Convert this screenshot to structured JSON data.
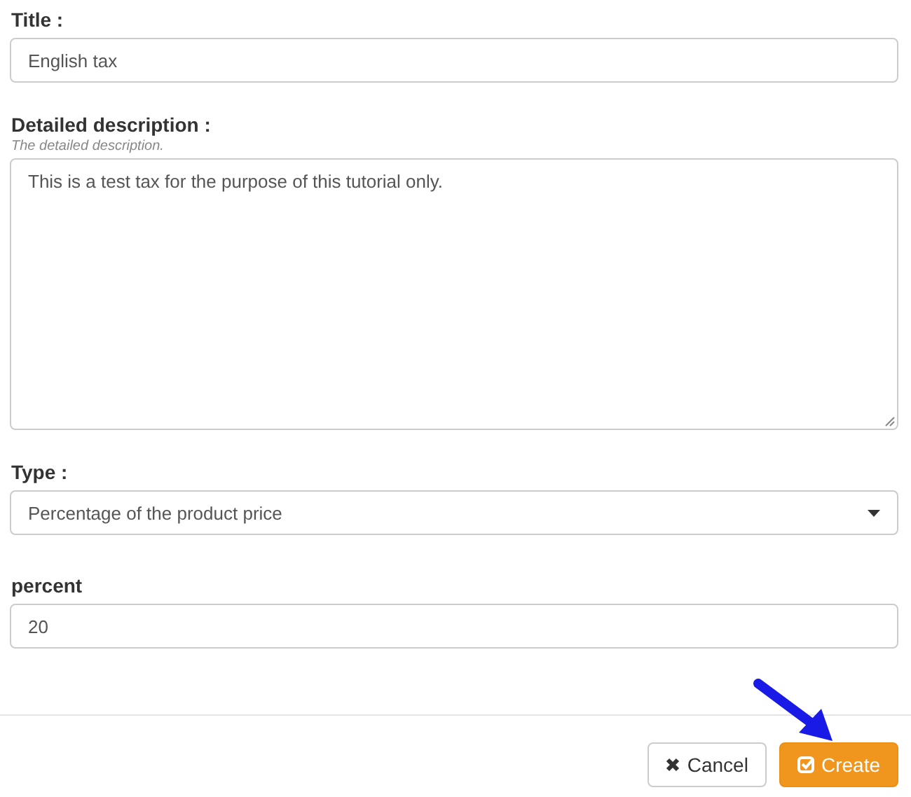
{
  "fields": [
    {
      "kind": "text",
      "label": "Title :",
      "value": "English tax"
    },
    {
      "kind": "textarea",
      "label": "Detailed description :",
      "help": "The detailed description.",
      "value": "This is a test tax for the purpose of this tutorial only."
    },
    {
      "kind": "select",
      "label": "Type :",
      "value": "Percentage of the product price"
    },
    {
      "kind": "text",
      "label": "percent",
      "value": "20"
    }
  ],
  "buttons": [
    {
      "kind": "cancel",
      "label": "Cancel"
    },
    {
      "kind": "create",
      "label": "Create"
    }
  ]
}
